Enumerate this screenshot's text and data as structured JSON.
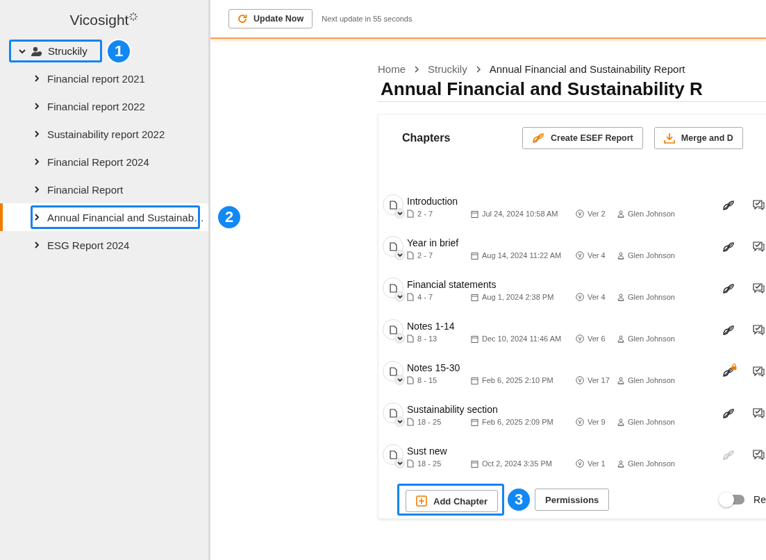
{
  "sidebar": {
    "logo": "Vicosight",
    "tree": {
      "label": "Struckily",
      "expanded": true,
      "annotation": "1",
      "children": [
        {
          "label": "Financial report 2021",
          "selected": false,
          "expanded": false
        },
        {
          "label": "Financial report 2022",
          "selected": false,
          "expanded": false
        },
        {
          "label": "Sustainability report 2022",
          "selected": false,
          "expanded": false
        },
        {
          "label": "Financial Report 2024",
          "selected": false,
          "expanded": false
        },
        {
          "label": "Financial Report",
          "selected": false,
          "expanded": false
        },
        {
          "label": "Annual Financial and Sustainab…",
          "selected": true,
          "expanded": false,
          "annotation": "2"
        },
        {
          "label": "ESG Report 2024",
          "selected": false,
          "expanded": false
        }
      ]
    }
  },
  "topbar": {
    "update_button": "Update Now",
    "next_update": "Next update in 55 seconds"
  },
  "breadcrumb": [
    "Home",
    "Struckily",
    "Annual Financial and Sustainability Report"
  ],
  "title": "Annual Financial and Sustainability R",
  "chapters": {
    "heading": "Chapters",
    "actions": [
      "Create ESEF Report",
      "Merge and D"
    ],
    "rows": [
      {
        "name": "Introduction",
        "pages": "2 - 7",
        "date": "Jul 24, 2024 10:58 AM",
        "version": "Ver 2",
        "author": "Glen Johnson",
        "esef_locked": false,
        "esef_disabled": false
      },
      {
        "name": "Year in brief",
        "pages": "2 - 7",
        "date": "Aug 14, 2024 11:22 AM",
        "version": "Ver 4",
        "author": "Glen Johnson",
        "esef_locked": false,
        "esef_disabled": false
      },
      {
        "name": "Financial statements",
        "pages": "4 - 7",
        "date": "Aug 1, 2024 2:38 PM",
        "version": "Ver 4",
        "author": "Glen Johnson",
        "esef_locked": false,
        "esef_disabled": false
      },
      {
        "name": "Notes 1-14",
        "pages": "8 - 13",
        "date": "Dec 10, 2024 11:46 AM",
        "version": "Ver 6",
        "author": "Glen Johnson",
        "esef_locked": false,
        "esef_disabled": false
      },
      {
        "name": "Notes 15-30",
        "pages": "8 - 15",
        "date": "Feb 6, 2025 2:10 PM",
        "version": "Ver 17",
        "author": "Glen Johnson",
        "esef_locked": true,
        "esef_disabled": false
      },
      {
        "name": "Sustainability section",
        "pages": "18 - 25",
        "date": "Feb 6, 2025 2:09 PM",
        "version": "Ver 9",
        "author": "Glen Johnson",
        "esef_locked": false,
        "esef_disabled": false
      },
      {
        "name": "Sust new",
        "pages": "18 - 25",
        "date": "Oct 2, 2024 3:35 PM",
        "version": "Ver 1",
        "author": "Glen Johnson",
        "esef_locked": false,
        "esef_disabled": true
      }
    ],
    "add_button": {
      "label": "Add Chapter",
      "annotation": "3"
    },
    "permissions_button": "Permissions",
    "toggle": {
      "on": false,
      "label": "Re"
    }
  }
}
